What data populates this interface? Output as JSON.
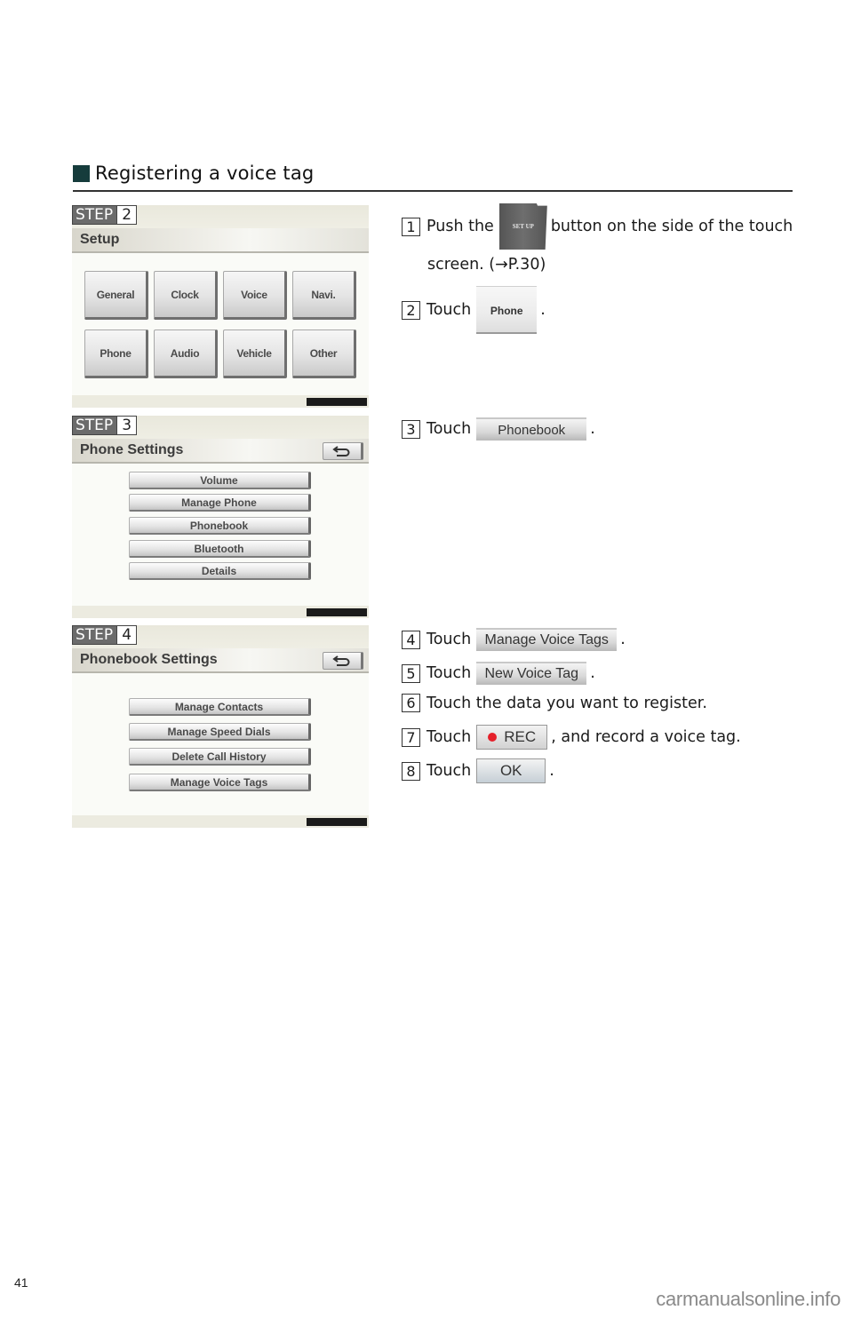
{
  "section": {
    "title": "Registering a voice tag",
    "bullet_icon": "square-bullet-icon"
  },
  "steps": [
    {
      "step_label": "STEP",
      "step_number": "2",
      "screen": {
        "title": "Setup",
        "buttons": [
          "General",
          "Clock",
          "Voice",
          "Navi.",
          "Phone",
          "Audio",
          "Vehicle",
          "Other"
        ]
      }
    },
    {
      "step_label": "STEP",
      "step_number": "3",
      "screen": {
        "title": "Phone Settings",
        "back_icon": "return-arrow-icon",
        "buttons": [
          "Volume",
          "Manage Phone",
          "Phonebook",
          "Bluetooth",
          "Details"
        ]
      }
    },
    {
      "step_label": "STEP",
      "step_number": "4",
      "screen": {
        "title": "Phonebook Settings",
        "back_icon": "return-arrow-icon",
        "buttons": [
          "Manage Contacts",
          "Manage Speed Dials",
          "Delete Call History",
          "Manage Voice Tags"
        ]
      }
    }
  ],
  "instructions": [
    {
      "num": "1",
      "before": "Push the",
      "button": "SET UP",
      "after": "button on the side of the touch",
      "line2": "screen. (→P.30)"
    },
    {
      "num": "2",
      "before": "Touch",
      "button": "Phone",
      "after": "."
    },
    {
      "num": "3",
      "before": "Touch",
      "button": "Phonebook",
      "after": "."
    },
    {
      "num": "4",
      "before": "Touch",
      "button": "Manage Voice Tags",
      "after": "."
    },
    {
      "num": "5",
      "before": "Touch",
      "button": "New Voice Tag",
      "after": "."
    },
    {
      "num": "6",
      "text": "Touch the data you want to register."
    },
    {
      "num": "7",
      "before": "Touch",
      "button": "REC",
      "after": ", and record a voice tag."
    },
    {
      "num": "8",
      "before": "Touch",
      "button": "OK",
      "after": "."
    }
  ],
  "colors": {
    "section_bullet": "#163c3c",
    "rec_dot": "#e5202a",
    "step_label_bg": "#6b6b6b"
  },
  "footer": {
    "page_number": "41",
    "watermark": "carmanualsonline.info"
  }
}
